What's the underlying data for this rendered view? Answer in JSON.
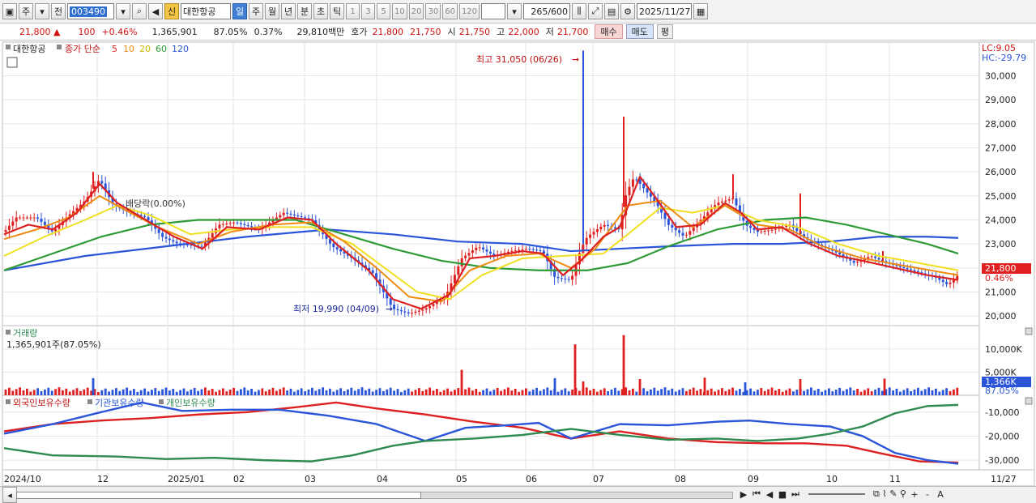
{
  "toolbar": {
    "type": "주",
    "prev": "전",
    "code": "003490",
    "search_icon": "search-icon",
    "sin": "신",
    "name": "대한항공",
    "periods": [
      "일",
      "주",
      "월",
      "년",
      "분",
      "초",
      "틱"
    ],
    "numbers": [
      "1",
      "3",
      "5",
      "10",
      "20",
      "30",
      "60",
      "120"
    ],
    "count": "265",
    "count_max": "/600",
    "date": "2025/11/27"
  },
  "quote": {
    "price": "21,800",
    "change": "100",
    "change_pct": "+0.46%",
    "volume": "1,365,901",
    "vol_ratio": "87.05%",
    "turnover": "0.37%",
    "amount": "29,810백만",
    "hoga_label": "호가",
    "bid": "21,800",
    "ask": "21,750",
    "open_label": "시",
    "open": "21,750",
    "high_label": "고",
    "high": "22,000",
    "low_label": "저",
    "low": "21,700",
    "buy": "매수",
    "sell": "매도",
    "avg": "평"
  },
  "chart_data": {
    "type": "line",
    "price_panel": {
      "legend": {
        "name": "대한항공",
        "label": "종가 단순",
        "mas": [
          "5",
          "10",
          "20",
          "60",
          "120"
        ]
      },
      "ylim": [
        19600,
        31400
      ],
      "yticks": [
        "20,000",
        "21,000",
        "22,000",
        "23,000",
        "24,000",
        "25,000",
        "26,000",
        "27,000",
        "28,000",
        "29,000",
        "30,000"
      ],
      "lc": "LC:9.05",
      "hc": "HC:-29.79",
      "high_annot": "최고 31,050 (06/26)",
      "low_annot": "최저 19,990 (04/09)",
      "ex_annot": "배당락(0.00%)",
      "last_price": "21,800",
      "last_pct": "0.46%"
    },
    "volume_panel": {
      "title": "거래량",
      "value": "1,365,901주(87.05%)",
      "yticks": [
        "5,000K",
        "10,000K"
      ],
      "last": "1,366K",
      "last_pct": "87.05%"
    },
    "holdings_panel": {
      "legends": [
        "외국인보유수량",
        "기관보유수량",
        "개인보유수량"
      ],
      "yticks": [
        "-10,000",
        "-20,000",
        "-30,000"
      ]
    },
    "xlabels": [
      "2024/10",
      "12",
      "2025/01",
      "02",
      "03",
      "04",
      "05",
      "06",
      "07",
      "08",
      "09",
      "10",
      "11",
      "11/27"
    ],
    "xlabel_pos": [
      0,
      115,
      202,
      283,
      371,
      460,
      558,
      644,
      727,
      828,
      918,
      1015,
      1093,
      1218
    ],
    "price": {
      "knots": [
        [
          0,
          23500
        ],
        [
          15,
          24100
        ],
        [
          40,
          24100
        ],
        [
          60,
          23500
        ],
        [
          80,
          24200
        ],
        [
          100,
          24800
        ],
        [
          118,
          25700
        ],
        [
          135,
          24600
        ],
        [
          155,
          24300
        ],
        [
          175,
          24100
        ],
        [
          195,
          23300
        ],
        [
          215,
          23000
        ],
        [
          245,
          22900
        ],
        [
          265,
          23800
        ],
        [
          285,
          23900
        ],
        [
          315,
          23600
        ],
        [
          345,
          24300
        ],
        [
          380,
          24000
        ],
        [
          405,
          22900
        ],
        [
          430,
          22400
        ],
        [
          455,
          21800
        ],
        [
          480,
          20300
        ],
        [
          500,
          20100
        ],
        [
          520,
          20300
        ],
        [
          545,
          20800
        ],
        [
          565,
          22400
        ],
        [
          585,
          22900
        ],
        [
          605,
          22500
        ],
        [
          625,
          22700
        ],
        [
          645,
          22800
        ],
        [
          665,
          22700
        ],
        [
          680,
          21600
        ],
        [
          700,
          21500
        ],
        [
          712,
          22800
        ],
        [
          720,
          23300
        ],
        [
          740,
          23800
        ],
        [
          760,
          23600
        ],
        [
          768,
          25100
        ],
        [
          778,
          25800
        ],
        [
          790,
          25300
        ],
        [
          805,
          24700
        ],
        [
          820,
          23800
        ],
        [
          840,
          23300
        ],
        [
          860,
          24000
        ],
        [
          880,
          24700
        ],
        [
          900,
          24900
        ],
        [
          915,
          23800
        ],
        [
          930,
          23500
        ],
        [
          950,
          23600
        ],
        [
          970,
          23800
        ],
        [
          990,
          23200
        ],
        [
          1010,
          22900
        ],
        [
          1030,
          22600
        ],
        [
          1050,
          22200
        ],
        [
          1070,
          22500
        ],
        [
          1090,
          22200
        ],
        [
          1110,
          22000
        ],
        [
          1130,
          21800
        ],
        [
          1150,
          21600
        ],
        [
          1165,
          21300
        ],
        [
          1178,
          21700
        ]
      ],
      "spikes": [
        [
          110,
          26000
        ],
        [
          715,
          31050
        ],
        [
          765,
          28300
        ],
        [
          983,
          25100
        ],
        [
          900,
          25900
        ],
        [
          1085,
          22700
        ]
      ]
    },
    "ma": {
      "ma5": {
        "color": "#dd2020",
        "knots": [
          [
            0,
            23400
          ],
          [
            30,
            23800
          ],
          [
            60,
            23600
          ],
          [
            90,
            24300
          ],
          [
            118,
            25500
          ],
          [
            140,
            24700
          ],
          [
            170,
            24100
          ],
          [
            210,
            23300
          ],
          [
            245,
            22800
          ],
          [
            275,
            23700
          ],
          [
            315,
            23600
          ],
          [
            350,
            24100
          ],
          [
            380,
            24000
          ],
          [
            410,
            23000
          ],
          [
            450,
            21900
          ],
          [
            480,
            20700
          ],
          [
            515,
            20300
          ],
          [
            550,
            20900
          ],
          [
            575,
            22400
          ],
          [
            605,
            22500
          ],
          [
            640,
            22700
          ],
          [
            665,
            22600
          ],
          [
            690,
            21700
          ],
          [
            712,
            22300
          ],
          [
            740,
            23300
          ],
          [
            760,
            23700
          ],
          [
            785,
            25800
          ],
          [
            805,
            24900
          ],
          [
            830,
            23700
          ],
          [
            860,
            23800
          ],
          [
            890,
            24700
          ],
          [
            910,
            24300
          ],
          [
            930,
            23600
          ],
          [
            960,
            23700
          ],
          [
            995,
            23000
          ],
          [
            1030,
            22500
          ],
          [
            1060,
            22300
          ],
          [
            1100,
            22000
          ],
          [
            1140,
            21700
          ],
          [
            1178,
            21500
          ]
        ]
      },
      "ma10": {
        "color": "#f08a10",
        "knots": [
          [
            0,
            23200
          ],
          [
            40,
            23600
          ],
          [
            80,
            24100
          ],
          [
            118,
            25000
          ],
          [
            150,
            24400
          ],
          [
            190,
            23700
          ],
          [
            240,
            23000
          ],
          [
            280,
            23500
          ],
          [
            330,
            23800
          ],
          [
            380,
            23900
          ],
          [
            420,
            23100
          ],
          [
            460,
            22000
          ],
          [
            500,
            20800
          ],
          [
            540,
            20600
          ],
          [
            575,
            21900
          ],
          [
            620,
            22500
          ],
          [
            660,
            22600
          ],
          [
            700,
            22000
          ],
          [
            730,
            22800
          ],
          [
            770,
            24600
          ],
          [
            810,
            24800
          ],
          [
            850,
            23700
          ],
          [
            890,
            24600
          ],
          [
            930,
            23800
          ],
          [
            970,
            23600
          ],
          [
            1010,
            22900
          ],
          [
            1060,
            22400
          ],
          [
            1110,
            22100
          ],
          [
            1178,
            21700
          ]
        ]
      },
      "ma20": {
        "color": "#f0e020",
        "knots": [
          [
            0,
            22500
          ],
          [
            50,
            23300
          ],
          [
            100,
            24000
          ],
          [
            140,
            24600
          ],
          [
            180,
            24200
          ],
          [
            230,
            23400
          ],
          [
            280,
            23600
          ],
          [
            330,
            23700
          ],
          [
            380,
            23700
          ],
          [
            430,
            23000
          ],
          [
            470,
            22000
          ],
          [
            510,
            21000
          ],
          [
            550,
            20700
          ],
          [
            590,
            21700
          ],
          [
            640,
            22400
          ],
          [
            690,
            22500
          ],
          [
            740,
            22600
          ],
          [
            770,
            23400
          ],
          [
            810,
            24500
          ],
          [
            850,
            24300
          ],
          [
            890,
            24600
          ],
          [
            930,
            24000
          ],
          [
            980,
            23700
          ],
          [
            1030,
            23000
          ],
          [
            1080,
            22500
          ],
          [
            1130,
            22200
          ],
          [
            1178,
            21900
          ]
        ]
      },
      "ma60": {
        "color": "#2e9a35",
        "knots": [
          [
            0,
            21900
          ],
          [
            60,
            22600
          ],
          [
            120,
            23300
          ],
          [
            180,
            23800
          ],
          [
            240,
            24000
          ],
          [
            300,
            24000
          ],
          [
            360,
            24000
          ],
          [
            420,
            23400
          ],
          [
            480,
            22800
          ],
          [
            540,
            22300
          ],
          [
            600,
            22000
          ],
          [
            660,
            21900
          ],
          [
            720,
            21900
          ],
          [
            770,
            22200
          ],
          [
            820,
            22900
          ],
          [
            880,
            23600
          ],
          [
            940,
            24000
          ],
          [
            990,
            24100
          ],
          [
            1040,
            23800
          ],
          [
            1090,
            23400
          ],
          [
            1140,
            23000
          ],
          [
            1178,
            22600
          ]
        ]
      },
      "ma120": {
        "color": "#2a55d8",
        "knots": [
          [
            0,
            21900
          ],
          [
            100,
            22500
          ],
          [
            200,
            22900
          ],
          [
            300,
            23300
          ],
          [
            400,
            23600
          ],
          [
            480,
            23400
          ],
          [
            560,
            23100
          ],
          [
            640,
            23000
          ],
          [
            700,
            22700
          ],
          [
            760,
            22800
          ],
          [
            820,
            22900
          ],
          [
            900,
            23000
          ],
          [
            960,
            23000
          ],
          [
            1020,
            23100
          ],
          [
            1080,
            23300
          ],
          [
            1140,
            23300
          ],
          [
            1178,
            23250
          ]
        ]
      }
    },
    "holdings": {
      "foreign": {
        "color": "#dd2020",
        "knots": [
          [
            0,
            -18000
          ],
          [
            60,
            -15000
          ],
          [
            120,
            -13500
          ],
          [
            180,
            -12500
          ],
          [
            240,
            -11000
          ],
          [
            300,
            -10000
          ],
          [
            360,
            -8000
          ],
          [
            410,
            -6000
          ],
          [
            460,
            -8500
          ],
          [
            520,
            -11000
          ],
          [
            580,
            -14000
          ],
          [
            640,
            -16500
          ],
          [
            700,
            -21000
          ],
          [
            760,
            -18000
          ],
          [
            820,
            -21000
          ],
          [
            880,
            -22500
          ],
          [
            940,
            -23000
          ],
          [
            990,
            -23000
          ],
          [
            1040,
            -24000
          ],
          [
            1080,
            -27000
          ],
          [
            1130,
            -30500
          ],
          [
            1178,
            -31000
          ]
        ]
      },
      "inst": {
        "color": "#2a55d8",
        "knots": [
          [
            0,
            -19000
          ],
          [
            60,
            -15000
          ],
          [
            120,
            -10000
          ],
          [
            170,
            -6000
          ],
          [
            220,
            -9500
          ],
          [
            280,
            -9000
          ],
          [
            340,
            -9000
          ],
          [
            400,
            -11500
          ],
          [
            460,
            -15000
          ],
          [
            520,
            -22000
          ],
          [
            570,
            -16500
          ],
          [
            620,
            -15500
          ],
          [
            660,
            -14500
          ],
          [
            700,
            -21000
          ],
          [
            760,
            -15000
          ],
          [
            820,
            -15500
          ],
          [
            880,
            -14000
          ],
          [
            920,
            -13500
          ],
          [
            970,
            -15000
          ],
          [
            1020,
            -16000
          ],
          [
            1060,
            -20000
          ],
          [
            1100,
            -27000
          ],
          [
            1140,
            -30000
          ],
          [
            1178,
            -31500
          ]
        ]
      },
      "indiv": {
        "color": "#2e8a50",
        "knots": [
          [
            0,
            -25000
          ],
          [
            60,
            -28000
          ],
          [
            140,
            -28500
          ],
          [
            200,
            -29500
          ],
          [
            260,
            -29000
          ],
          [
            320,
            -30000
          ],
          [
            380,
            -30500
          ],
          [
            430,
            -28000
          ],
          [
            480,
            -24000
          ],
          [
            520,
            -22000
          ],
          [
            580,
            -21000
          ],
          [
            640,
            -19500
          ],
          [
            700,
            -17000
          ],
          [
            760,
            -19500
          ],
          [
            820,
            -21500
          ],
          [
            880,
            -21000
          ],
          [
            930,
            -22000
          ],
          [
            980,
            -21000
          ],
          [
            1020,
            -19000
          ],
          [
            1060,
            -16000
          ],
          [
            1100,
            -10500
          ],
          [
            1140,
            -7500
          ],
          [
            1178,
            -7000
          ]
        ]
      }
    },
    "volume_spikes": [
      [
        110,
        3700
      ],
      [
        565,
        5500
      ],
      [
        680,
        3700
      ],
      [
        705,
        11000
      ],
      [
        715,
        3000
      ],
      [
        765,
        13000
      ],
      [
        785,
        3500
      ],
      [
        865,
        3800
      ],
      [
        915,
        2800
      ],
      [
        983,
        3500
      ],
      [
        1087,
        3600
      ]
    ]
  },
  "bottom": {
    "controls": [
      "▶",
      "⏮",
      "◀",
      "■",
      "⏭"
    ],
    "tools": [
      "+",
      "-",
      "A"
    ]
  }
}
